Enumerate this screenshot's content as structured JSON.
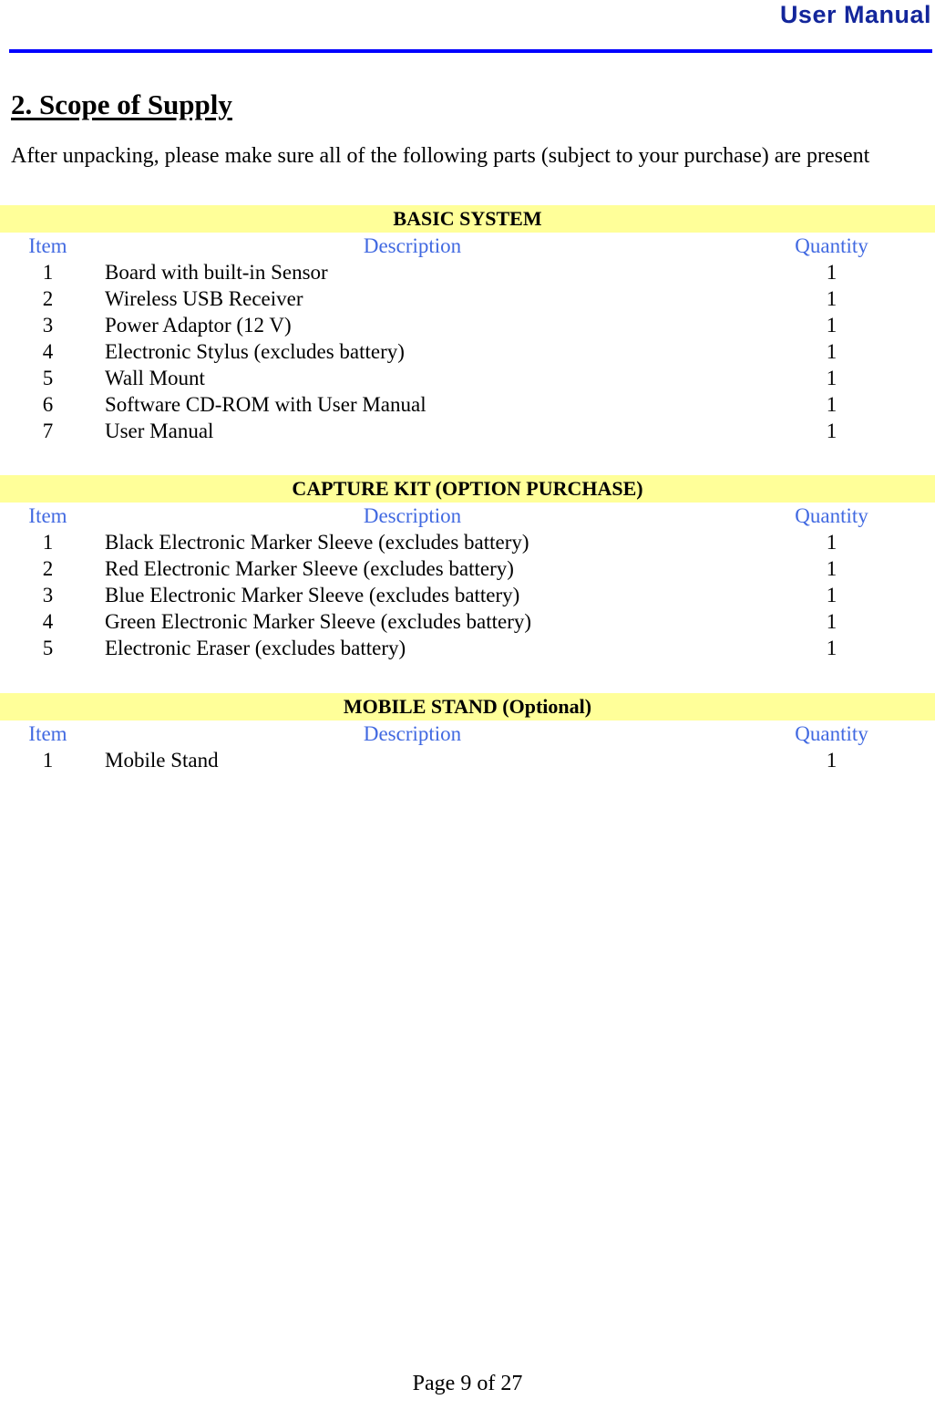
{
  "header": {
    "title": "User Manual"
  },
  "section": {
    "heading": "2. Scope of Supply",
    "intro": "After unpacking, please make sure all of the following parts (subject to your purchase) are present"
  },
  "columns": {
    "item": "Item",
    "description": "Description",
    "quantity": "Quantity"
  },
  "colors": {
    "header_title": "#13269B",
    "header_rule": "#0000FF",
    "table_title_bg": "#FFFF99",
    "column_header_text": "#4169E1"
  },
  "tables": [
    {
      "title": "BASIC SYSTEM",
      "rows": [
        {
          "item": "1",
          "description": "Board with built-in Sensor",
          "quantity": "1"
        },
        {
          "item": "2",
          "description": "Wireless USB Receiver",
          "quantity": "1"
        },
        {
          "item": "3",
          "description": "Power Adaptor (12 V)",
          "quantity": "1"
        },
        {
          "item": "4",
          "description": "Electronic Stylus (excludes battery)",
          "quantity": "1"
        },
        {
          "item": "5",
          "description": "Wall Mount",
          "quantity": "1"
        },
        {
          "item": "6",
          "description": "Software CD-ROM with User Manual",
          "quantity": "1"
        },
        {
          "item": "7",
          "description": "User Manual",
          "quantity": "1"
        }
      ]
    },
    {
      "title": "CAPTURE KIT (OPTION PURCHASE)",
      "rows": [
        {
          "item": "1",
          "description": "Black Electronic Marker Sleeve (excludes battery)",
          "quantity": "1"
        },
        {
          "item": "2",
          "description": "Red Electronic Marker Sleeve (excludes battery)",
          "quantity": "1"
        },
        {
          "item": "3",
          "description": "Blue Electronic Marker Sleeve (excludes battery)",
          "quantity": "1"
        },
        {
          "item": "4",
          "description": "Green Electronic Marker Sleeve (excludes battery)",
          "quantity": "1"
        },
        {
          "item": "5",
          "description": "Electronic Eraser (excludes battery)",
          "quantity": "1"
        }
      ]
    },
    {
      "title": "MOBILE STAND (Optional)",
      "rows": [
        {
          "item": "1",
          "description": "Mobile Stand",
          "quantity": "1"
        }
      ]
    }
  ],
  "footer": {
    "page_label": "Page 9 of 27"
  }
}
